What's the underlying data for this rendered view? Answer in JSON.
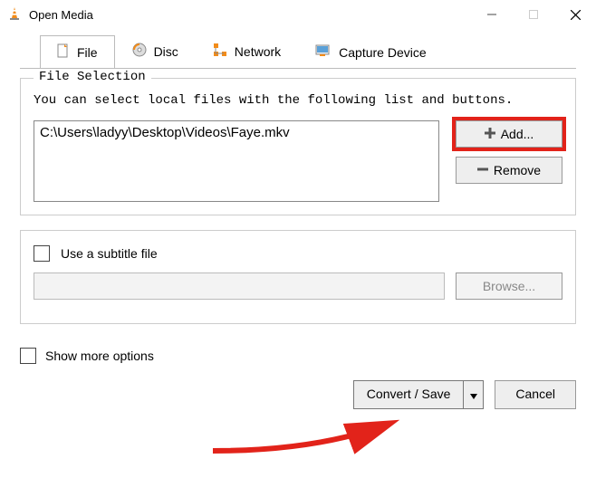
{
  "window": {
    "title": "Open Media"
  },
  "tabs": {
    "file": "File",
    "disc": "Disc",
    "network": "Network",
    "capture": "Capture Device"
  },
  "fileSelection": {
    "legend": "File Selection",
    "help": "You can select local files with the following list and buttons.",
    "files": {
      "0": "C:\\Users\\ladyy\\Desktop\\Videos\\Faye.mkv"
    },
    "addLabel": "Add...",
    "removeLabel": "Remove"
  },
  "subtitle": {
    "label": "Use a subtitle file",
    "browseLabel": "Browse..."
  },
  "moreOptions": {
    "label": "Show more options"
  },
  "actions": {
    "convertSaveLabel": "Convert / Save",
    "cancelLabel": "Cancel"
  }
}
